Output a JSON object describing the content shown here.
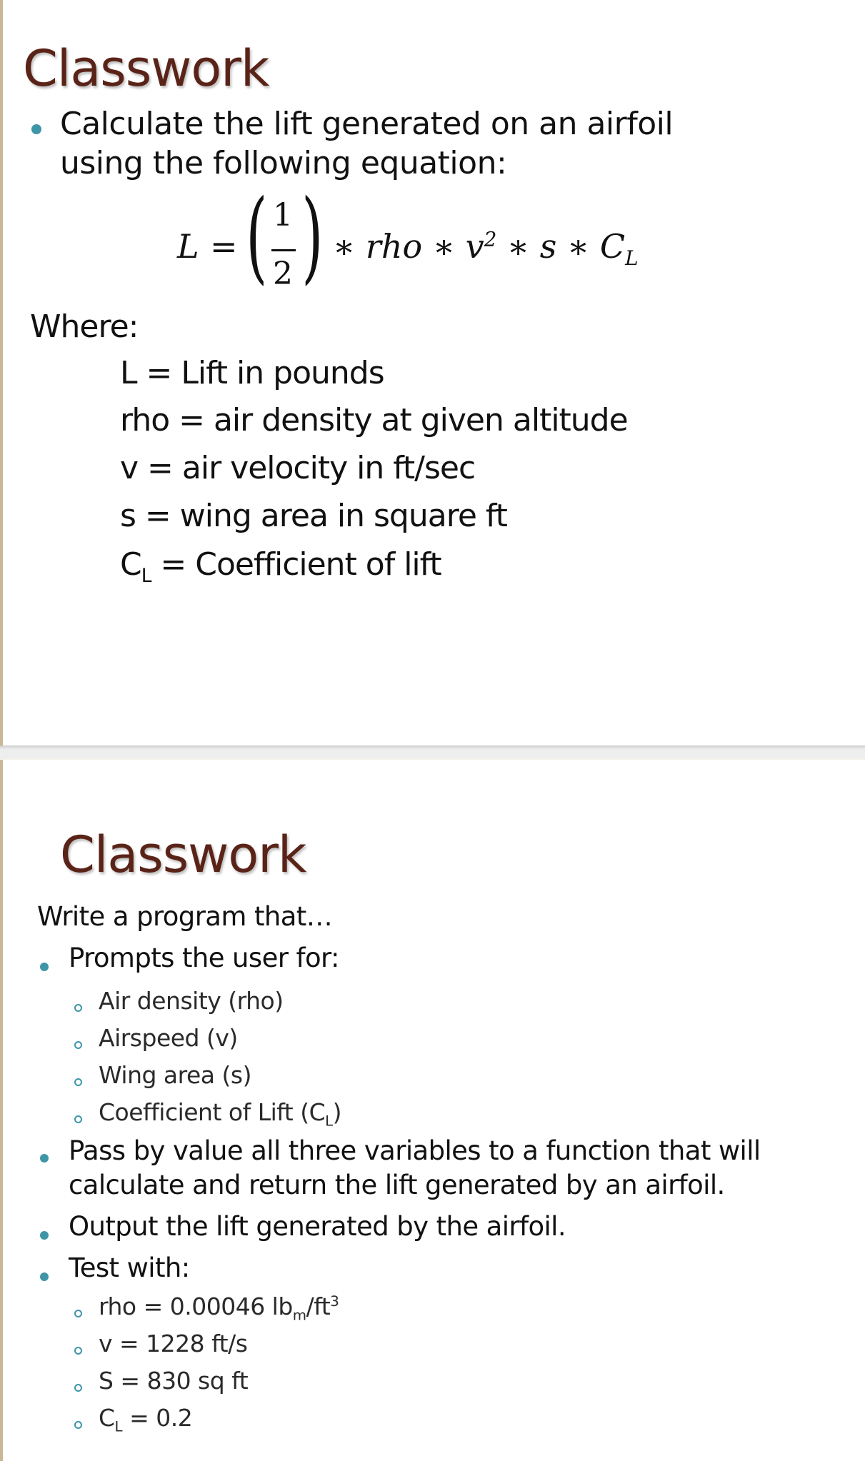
{
  "slides": [
    {
      "title": "Classwork",
      "bullet": {
        "line1": "Calculate the lift generated on an airfoil",
        "line2": "using the following equation:"
      },
      "equation": {
        "lhs": "L",
        "equals": "=",
        "frac_num": "1",
        "frac_den": "2",
        "rest_parts": [
          "∗ rho ∗ v",
          "2",
          " ∗ s ∗ C",
          "L"
        ]
      },
      "where_label": "Where:",
      "definitions": [
        {
          "symbol": "L",
          "sub": "",
          "text": " = Lift in pounds"
        },
        {
          "symbol": "rho",
          "sub": "",
          "text": " = air density at given altitude"
        },
        {
          "symbol": "v",
          "sub": "",
          "text": " = air velocity in ft/sec"
        },
        {
          "symbol": "s",
          "sub": "",
          "text": " = wing area in square ft"
        },
        {
          "symbol": "C",
          "sub": "L",
          "text": " = Coefficient of lift"
        }
      ]
    },
    {
      "title": "Classwork",
      "intro": "Write a program that…",
      "bullets": [
        {
          "text": "Prompts the user for:",
          "sub_items": [
            {
              "text": "Air density (rho)"
            },
            {
              "text": "Airspeed (v)"
            },
            {
              "text": "Wing area (s)"
            },
            {
              "text_before": "Coefficient of Lift (C",
              "sub": "L",
              "text_after": ")"
            }
          ]
        },
        {
          "line1": "Pass by value all three variables to a function that will",
          "line2": "calculate and return the lift generated by an airfoil."
        },
        {
          "text": "Output the lift generated by the airfoil."
        },
        {
          "text": "Test with:",
          "sub_items": [
            {
              "before": "rho = 0.00046 lb",
              "sub": "m",
              "mid": "/ft",
              "sup": "3"
            },
            {
              "text": "v = 1228 ft/s"
            },
            {
              "text": "S = 830 sq ft"
            },
            {
              "before": "C",
              "sub": "L",
              "after": " = 0.2"
            }
          ]
        }
      ]
    }
  ],
  "colors": {
    "title": "#5a2318",
    "bullet": "#3e95a8",
    "text": "#111111",
    "left_border": "#c9b896",
    "separator": "#eeeeee"
  }
}
